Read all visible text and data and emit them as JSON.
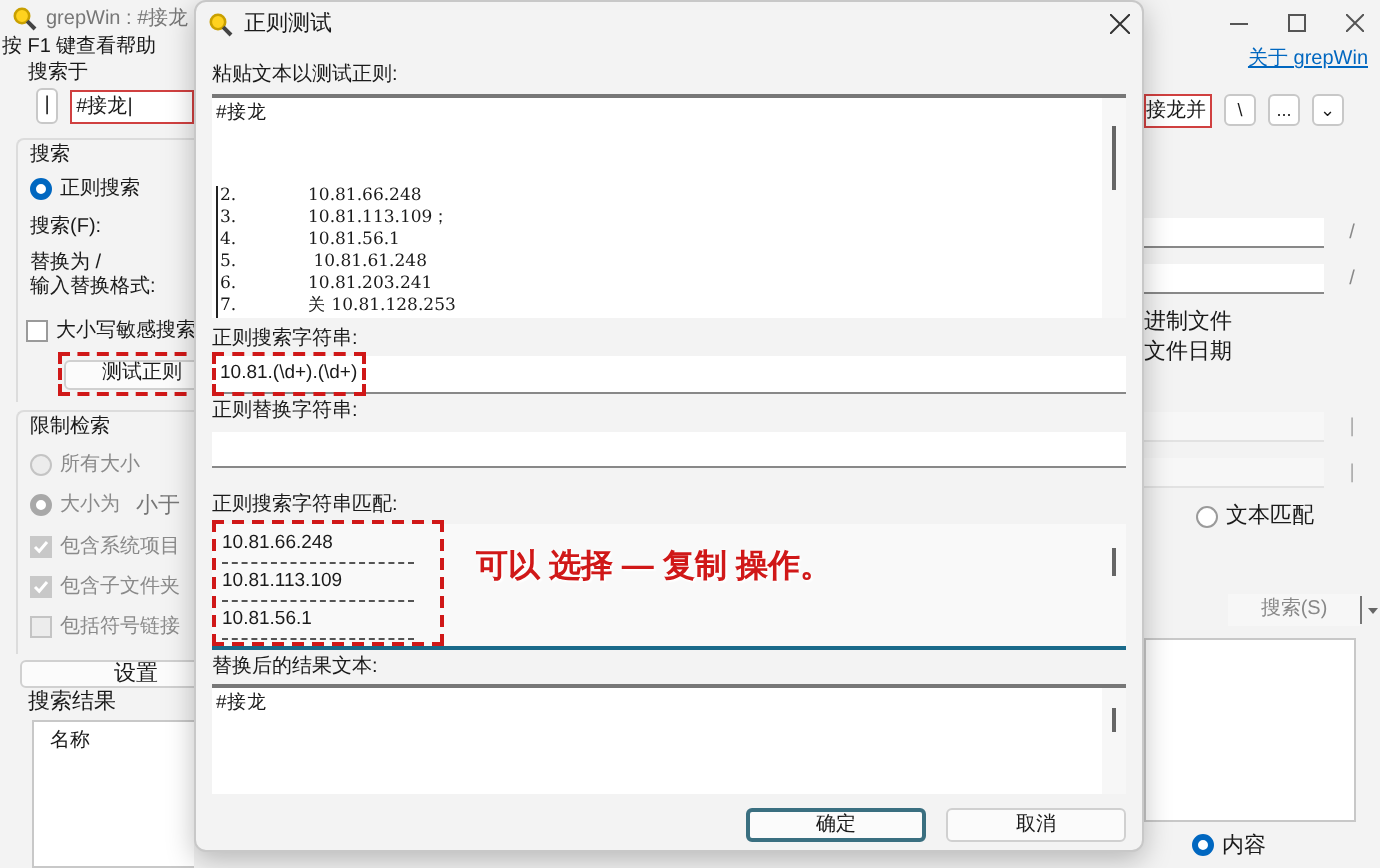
{
  "main_window": {
    "title": "grepWin : #接龙",
    "hint": "按 F1 键查看帮助",
    "about_link": "关于 grepWin",
    "search_in": {
      "label": "搜索于",
      "pick_button": "|",
      "left_value": "#接龙|",
      "right_value": "接龙并",
      "path_buttons": [
        "\\",
        "...",
        "⌄"
      ]
    },
    "search_group": {
      "title": "搜索",
      "mode_radio": {
        "label": "正则搜索",
        "selected": true
      },
      "search_label": "搜索(F):",
      "replace_label": [
        "替换为 /",
        "输入替换格式:"
      ],
      "slash_buttons": [
        "/",
        "/"
      ],
      "case_checkbox": {
        "label": "大小写敏感搜索",
        "checked": false
      },
      "test_button": {
        "label": "测试正则",
        "highlighted": true
      },
      "right_options": [
        "进制文件",
        "文件日期"
      ]
    },
    "limit_group": {
      "title": "限制检索",
      "size_options": [
        {
          "label": "所有大小",
          "selected": false,
          "disabled": true
        },
        {
          "label": "大小为",
          "selected": true,
          "disabled": true
        }
      ],
      "size_compare": "小于",
      "checkboxes": [
        {
          "label": "包含系统项目",
          "checked": true,
          "disabled": true
        },
        {
          "label": "包含子文件夹",
          "checked": true,
          "disabled": true
        },
        {
          "label": "包括符号链接",
          "checked": false,
          "disabled": true
        }
      ],
      "side_buttons": [
        "|",
        "|"
      ],
      "match_radio": {
        "label": "文本匹配",
        "selected": false
      }
    },
    "settings_button": "设置",
    "search_button": "搜索(S)",
    "results": {
      "title": "搜索结果",
      "columns": [
        "名称"
      ]
    },
    "show_radio": {
      "label": "内容",
      "selected": true
    }
  },
  "dialog": {
    "title": "正则测试",
    "text_label": "粘贴文本以测试正则:",
    "first_line": "#接龙",
    "lines": [
      {
        "num": "2.",
        "text": "10.81.66.248"
      },
      {
        "num": "3.",
        "text": "10.81.113.109；"
      },
      {
        "num": "4.",
        "text": "10.81.56.1"
      },
      {
        "num": "5.",
        "text": " 10.81.61.248"
      },
      {
        "num": "6.",
        "text": "10.81.203.241"
      },
      {
        "num": "7.",
        "text": "关 10.81.128.253"
      }
    ],
    "regex_label": "正则搜索字符串:",
    "regex_value": "10.81.(\\d+).(\\d+)",
    "regex_highlighted": true,
    "replace_label": "正则替换字符串:",
    "matches_label": "正则搜索字符串匹配:",
    "matches": [
      "10.81.66.248",
      "10.81.113.109",
      "10.81.56.1"
    ],
    "matches_highlighted": true,
    "note": "可以 选择 — 复制 操作。",
    "result_label": "替换后的结果文本:",
    "result_lines": [
      "#接龙"
    ],
    "buttons": [
      {
        "label": "确定",
        "default": true
      },
      {
        "label": "取消",
        "default": false
      }
    ]
  }
}
